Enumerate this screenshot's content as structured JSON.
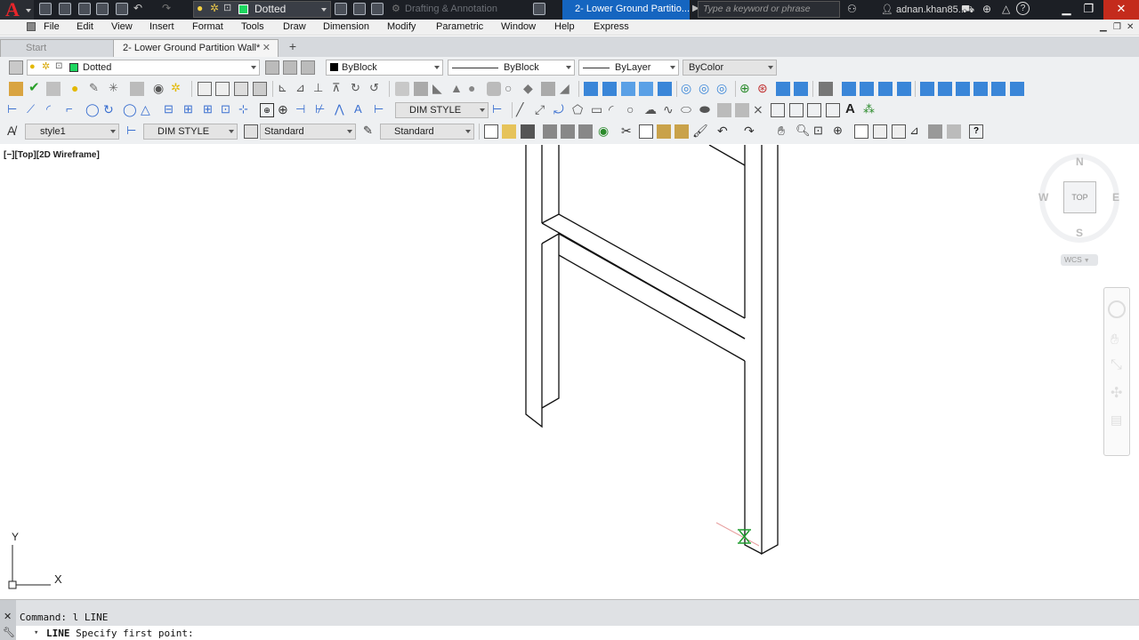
{
  "titlebar": {
    "layer_name": "Dotted",
    "workspace": "Drafting & Annotation",
    "doc_title": "2- Lower Ground Partitio...",
    "search_placeholder": "Type a keyword or phrase",
    "user": "adnan.khan85...",
    "help": "?"
  },
  "menu": [
    "File",
    "Edit",
    "View",
    "Insert",
    "Format",
    "Tools",
    "Draw",
    "Dimension",
    "Modify",
    "Parametric",
    "Window",
    "Help",
    "Express"
  ],
  "tabs": {
    "start": "Start",
    "active": "2- Lower Ground Partition Wall*",
    "add": "+"
  },
  "properties": {
    "layer": "Dotted",
    "color": "ByBlock",
    "linetype": "ByBlock",
    "lineweight": "ByLayer",
    "plotstyle": "ByColor"
  },
  "dim_toolbar": {
    "dim_style": "DIM STYLE"
  },
  "styles_toolbar": {
    "text_style": "style1",
    "dim_style": "DIM STYLE",
    "table_style": "Standard",
    "multileader_style": "Standard"
  },
  "viewport": {
    "label": "[−][Top][2D Wireframe]",
    "ucs_x": "X",
    "ucs_y": "Y"
  },
  "viewcube": {
    "face": "TOP",
    "north": "N",
    "south": "S",
    "east": "E",
    "west": "W",
    "wcs": "WCS"
  },
  "command": {
    "history": "Command: l LINE",
    "prompt_cmd": "LINE",
    "prompt_text": "Specify first point:"
  },
  "colors": {
    "accent": "#1565c0",
    "layer_swatch": "#1ed760",
    "crosshair": "#1a9a2a",
    "logo": "#e8262b"
  }
}
